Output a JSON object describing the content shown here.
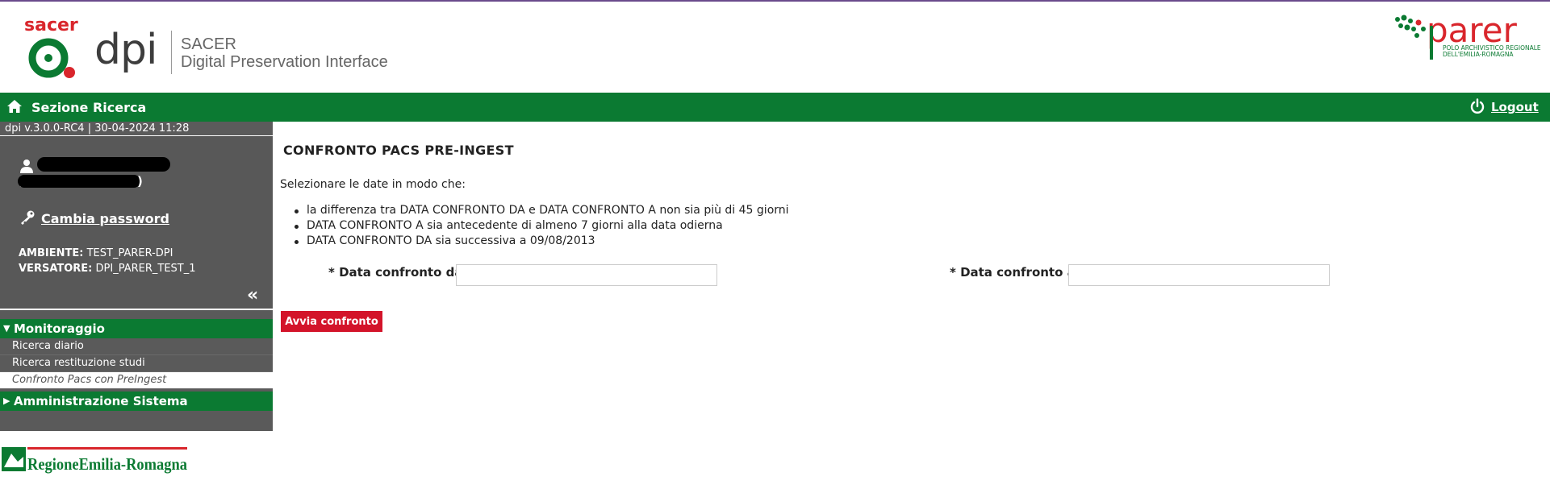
{
  "header": {
    "sacer_logo_text": "sacer",
    "dpi_text": "dpi",
    "app_name_line1": "SACER",
    "app_name_line2": "Digital Preservation Interface",
    "parer_logo_text": "parer",
    "parer_subtitle_line1": "POLO ARCHIVISTICO REGIONALE",
    "parer_subtitle_line2": "DELL'EMILIA-ROMAGNA"
  },
  "navbar": {
    "section_title": "Sezione Ricerca",
    "logout_label": "Logout"
  },
  "sidebar": {
    "version": "dpi v.3.0.0-RC4 | 30-04-2024 11:28",
    "change_password": "Cambia password",
    "ambiente_label": "AMBIENTE:",
    "ambiente_value": "TEST_PARER-DPI",
    "versatore_label": "VERSATORE:",
    "versatore_value": "DPI_PARER_TEST_1",
    "collapse_symbol": "«",
    "menu": {
      "group1": {
        "label": "Monitoraggio",
        "items": [
          "Ricerca diario",
          "Ricerca restituzione studi",
          "Confronto Pacs con PreIngest"
        ]
      },
      "group2": {
        "label": "Amministrazione Sistema"
      }
    },
    "footer_logo": "RegioneEmilia-Romagna"
  },
  "main": {
    "title": "CONFRONTO PACS PRE-INGEST",
    "intro": "Selezionare le date in modo che:",
    "rules": [
      "la differenza tra DATA CONFRONTO DA e DATA CONFRONTO A non sia più di 45 giorni",
      "DATA CONFRONTO A sia antecedente di almeno 7 giorni alla data odierna",
      "DATA CONFRONTO DA sia successiva a 09/08/2013"
    ],
    "field_from_label": "* Data confronto da",
    "field_from_value": "",
    "field_to_label": "* Data confronto a",
    "field_to_value": "",
    "submit_label": "Avvia confronto"
  },
  "colors": {
    "brand_green": "#0b7a32",
    "sidebar_gray": "#5a5a5a",
    "button_red": "#d3142a",
    "logo_red": "#d9262c"
  }
}
